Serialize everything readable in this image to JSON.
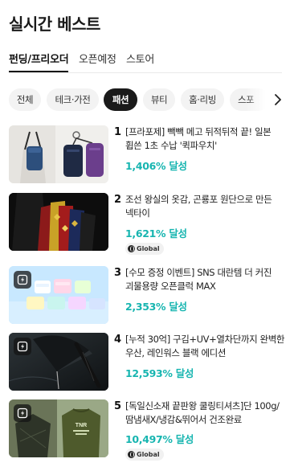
{
  "header": {
    "title": "실시간 베스트"
  },
  "main_tabs": [
    {
      "label": "펀딩/프리오더",
      "active": true
    },
    {
      "label": "오픈예정",
      "active": false
    },
    {
      "label": "스토어",
      "active": false
    }
  ],
  "categories": [
    {
      "label": "전체",
      "active": false
    },
    {
      "label": "테크·가전",
      "active": false
    },
    {
      "label": "패션",
      "active": true
    },
    {
      "label": "뷰티",
      "active": false
    },
    {
      "label": "홈·리빙",
      "active": false
    },
    {
      "label": "스포",
      "active": false
    }
  ],
  "items": [
    {
      "rank": "1",
      "name": "[프라포제] 빽빽 메고 뒤적뒤적 끝! 일본 휩쓴 1초 수납 '퀵파우치'",
      "rate": "1,406% 달성",
      "badge": "",
      "thumb_icon": ""
    },
    {
      "rank": "2",
      "name": "조선 왕실의 옷감, 곤룡포 원단으로 만든 넥타이",
      "rate": "1,621% 달성",
      "badge": "Global",
      "thumb_icon": ""
    },
    {
      "rank": "3",
      "name": "[수모 증정 이벤트] SNS 대란템 더 커진 괴물용량 오픈클럭 MAX",
      "rate": "2,353% 달성",
      "badge": "",
      "thumb_icon": "flash-icon"
    },
    {
      "rank": "4",
      "name": "[누적 30억] 구김+UV+열차단까지 완벽한 우산, 레인워스 블랙 에디션",
      "rate": "12,593% 달성",
      "badge": "",
      "thumb_icon": "flash-icon"
    },
    {
      "rank": "5",
      "name": "[독일신소재 끝판왕 쿨링티셔츠]단 100g/땀냄새X/냉감&뛰어서 건조완료",
      "rate": "10,497% 달성",
      "badge": "Global",
      "thumb_icon": "flash-icon"
    }
  ],
  "thumb_text": {
    "tshirt_print": "TNR"
  },
  "colors": {
    "accent": "#17b5b0",
    "active_chip": "#1a1a1a"
  }
}
